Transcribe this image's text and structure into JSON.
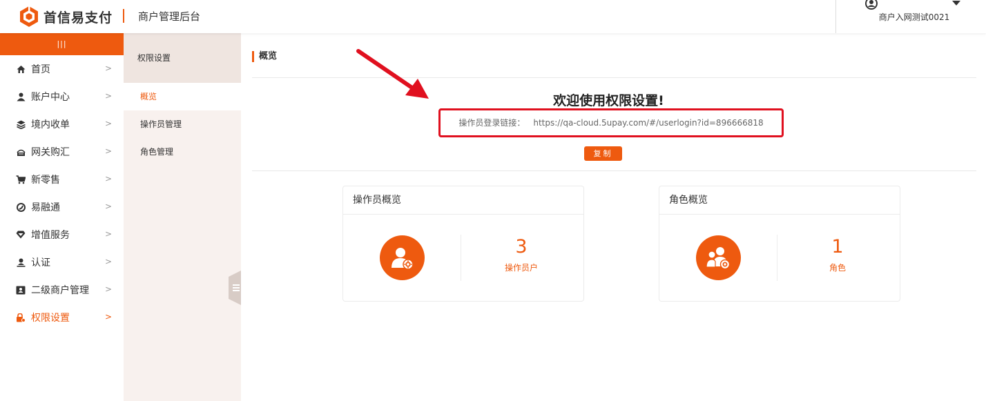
{
  "header": {
    "logo_text": "首信易支付",
    "title": "商户管理后台",
    "user_name": "商户入网测试0021"
  },
  "sidebar": {
    "toggle_label": "|||",
    "items": [
      {
        "label": "首页",
        "icon": "home-icon"
      },
      {
        "label": "账户中心",
        "icon": "user-icon"
      },
      {
        "label": "境内收单",
        "icon": "layers-icon"
      },
      {
        "label": "网关购汇",
        "icon": "gateway-icon"
      },
      {
        "label": "新零售",
        "icon": "cart-icon"
      },
      {
        "label": "易融通",
        "icon": "finance-icon"
      },
      {
        "label": "增值服务",
        "icon": "diamond-icon"
      },
      {
        "label": "认证",
        "icon": "certify-icon"
      },
      {
        "label": "二级商户管理",
        "icon": "merchant-card-icon"
      },
      {
        "label": "权限设置",
        "icon": "permission-icon",
        "active": true
      }
    ]
  },
  "subnav": {
    "title": "权限设置",
    "items": [
      {
        "label": "概览",
        "active": true
      },
      {
        "label": "操作员管理"
      },
      {
        "label": "角色管理"
      }
    ]
  },
  "content": {
    "breadcrumb": "概览",
    "welcome": "欢迎使用权限设置!",
    "link_label": "操作员登录链接：",
    "link_url": "https://qa-cloud.5upay.com/#/userlogin?id=896666818",
    "copy_label": "复制"
  },
  "cards": [
    {
      "title": "操作员概览",
      "count": "3",
      "unit": "操作员户",
      "icon": "operator-settings-icon"
    },
    {
      "title": "角色概览",
      "count": "1",
      "unit": "角色",
      "icon": "role-group-icon"
    }
  ],
  "colors": {
    "accent": "#ee5a0f",
    "highlight_border": "#e0101f",
    "subnav_bg": "#f8f1ee"
  }
}
